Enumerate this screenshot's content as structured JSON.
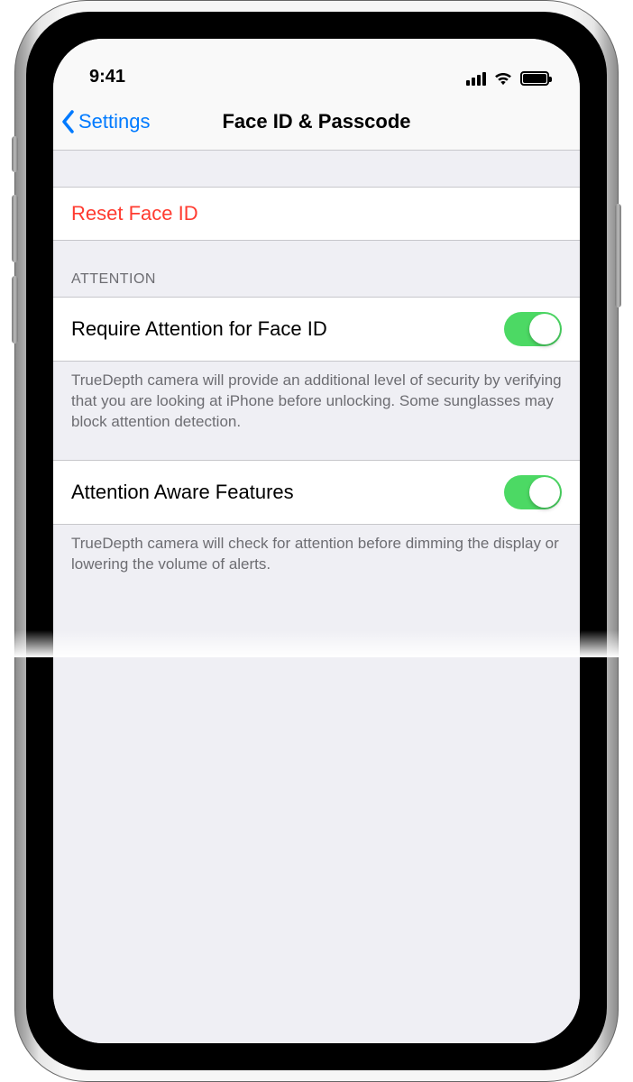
{
  "status": {
    "time": "9:41"
  },
  "nav": {
    "back_label": "Settings",
    "title": "Face ID & Passcode"
  },
  "reset": {
    "label": "Reset Face ID"
  },
  "section_attention": {
    "header": "ATTENTION",
    "require_attention": {
      "label": "Require Attention for Face ID",
      "on": true,
      "footer": "TrueDepth camera will provide an additional level of security by verifying that you are looking at iPhone before unlocking. Some sunglasses may block attention detection."
    },
    "attention_aware": {
      "label": "Attention Aware Features",
      "on": true,
      "footer": "TrueDepth camera will check for attention before dimming the display or lowering the volume of alerts."
    }
  }
}
